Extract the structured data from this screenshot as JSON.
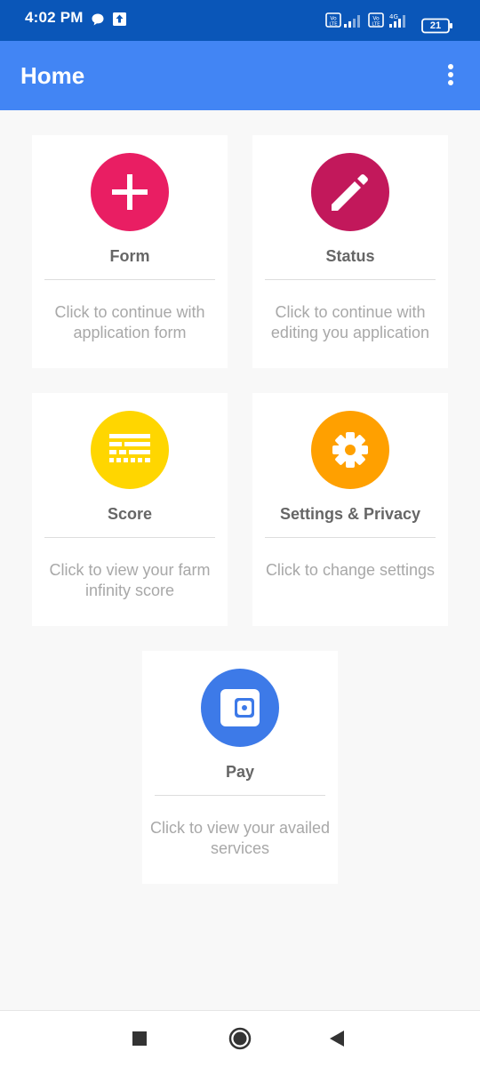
{
  "status_bar": {
    "time": "4:02 PM",
    "battery": "21"
  },
  "app_bar": {
    "title": "Home"
  },
  "cards": [
    {
      "label": "Form",
      "description": "Click to continue with application form",
      "color": "#e91e63",
      "icon": "plus-icon"
    },
    {
      "label": "Status",
      "description": "Click to continue with editing you application",
      "color": "#c2185b",
      "icon": "pencil-icon"
    },
    {
      "label": "Score",
      "description": "Click to view your farm infinity score",
      "color": "#ffd600",
      "icon": "scorecard-icon"
    },
    {
      "label": "Settings & Privacy",
      "description": "Click to change settings",
      "color": "#ffa000",
      "icon": "gear-icon"
    },
    {
      "label": "Pay",
      "description": "Click to view your availed services",
      "color": "#3d7ae8",
      "icon": "wallet-icon"
    }
  ]
}
